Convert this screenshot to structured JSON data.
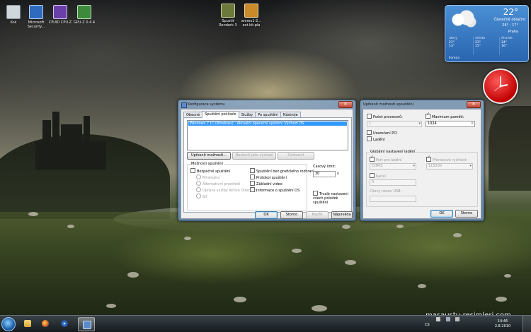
{
  "desktop_icons": [
    {
      "label": "Koš",
      "icon": "recycle-bin-icon",
      "color": "#cfd6dc"
    },
    {
      "label": "Microsoft Security...",
      "icon": "security-essentials-icon",
      "color": "#2e6bbf"
    },
    {
      "label": "CPUID CPU-Z",
      "icon": "cpu-z-icon",
      "color": "#6a3fa8"
    },
    {
      "label": "GPU-Z 0.4.4",
      "icon": "gpu-z-icon",
      "color": "#3d8a3d"
    },
    {
      "label": "Spustit Renderk 3",
      "icon": "app-shortcut-icon",
      "color": "#6b7a3a"
    },
    {
      "label": "annex1-2... ext.kit.pla",
      "icon": "app-shortcut-icon",
      "color": "#c98a2a"
    }
  ],
  "weather": {
    "temp": "22°",
    "condition": "Částečně oblačno",
    "range": "26° - 17°",
    "city": "Praha",
    "days": [
      {
        "name": "úterý",
        "hi": "21°",
        "lo": "13°"
      },
      {
        "name": "středa",
        "hi": "23°",
        "lo": "15°"
      },
      {
        "name": "čtvrtek",
        "hi": "24°",
        "lo": "16°"
      }
    ],
    "source": "Foreca"
  },
  "msconfig": {
    "title": "Konfigurace systému",
    "tabs": [
      "Obecné",
      "Spuštění počítače",
      "Služby",
      "Po spuštění",
      "Nástroje"
    ],
    "active_tab": 1,
    "os_entry": "Windows 7 (C:\\Windows) : Aktuální operační systém; Výchozí OS",
    "buttons_row": {
      "advanced": "Upřesnit možnosti...",
      "set_default": "Nastavit jako výchozí",
      "delete": "Odstranit"
    },
    "boot_options_label": "Možnosti spuštění",
    "safe_boot": "Bezpečné spuštění",
    "safe_boot_modes": [
      "Minimální",
      "Alternativní prostředí",
      "Oprava služby Active Directory",
      "Síť"
    ],
    "right_options": [
      "Spuštění bez grafického rozhraní",
      "Protokol spuštění",
      "Základní video",
      "Informace o spuštění OS"
    ],
    "timeout_label": "Časový limit:",
    "timeout_value": "30",
    "timeout_unit": "s",
    "permanent": "Trvalé nastavení všech položek spuštění",
    "footer": {
      "ok": "OK",
      "cancel": "Storno",
      "apply": "Použít",
      "help": "Nápověda"
    }
  },
  "advanced": {
    "title": "Upřesnit možnosti spouštění",
    "num_processors": "Počet procesorů:",
    "processors_value": "1",
    "max_memory": "Maximum paměti:",
    "max_memory_value": "1024",
    "pci_lock": "Uzamčení PCI",
    "debug": "Ladění",
    "global_debug": "Globální nastavení ladění",
    "debug_port": "Port pro ladění",
    "debug_port_value": "COM1:",
    "baud_rate": "Přenosová rychlost:",
    "baud_rate_value": "115200",
    "channel": "Kanál",
    "channel_value": "0",
    "usb_target": "Cílový název USB:",
    "ok": "OK",
    "cancel": "Storno"
  },
  "taskbar": {
    "lang": "CS",
    "time": "14:46",
    "date": "2.8.2010"
  },
  "watermark": "masaustu-resimleri.com",
  "colors": {
    "selection": "#3399ff",
    "clock": "#d40000",
    "weather": "#3b7cc8"
  }
}
